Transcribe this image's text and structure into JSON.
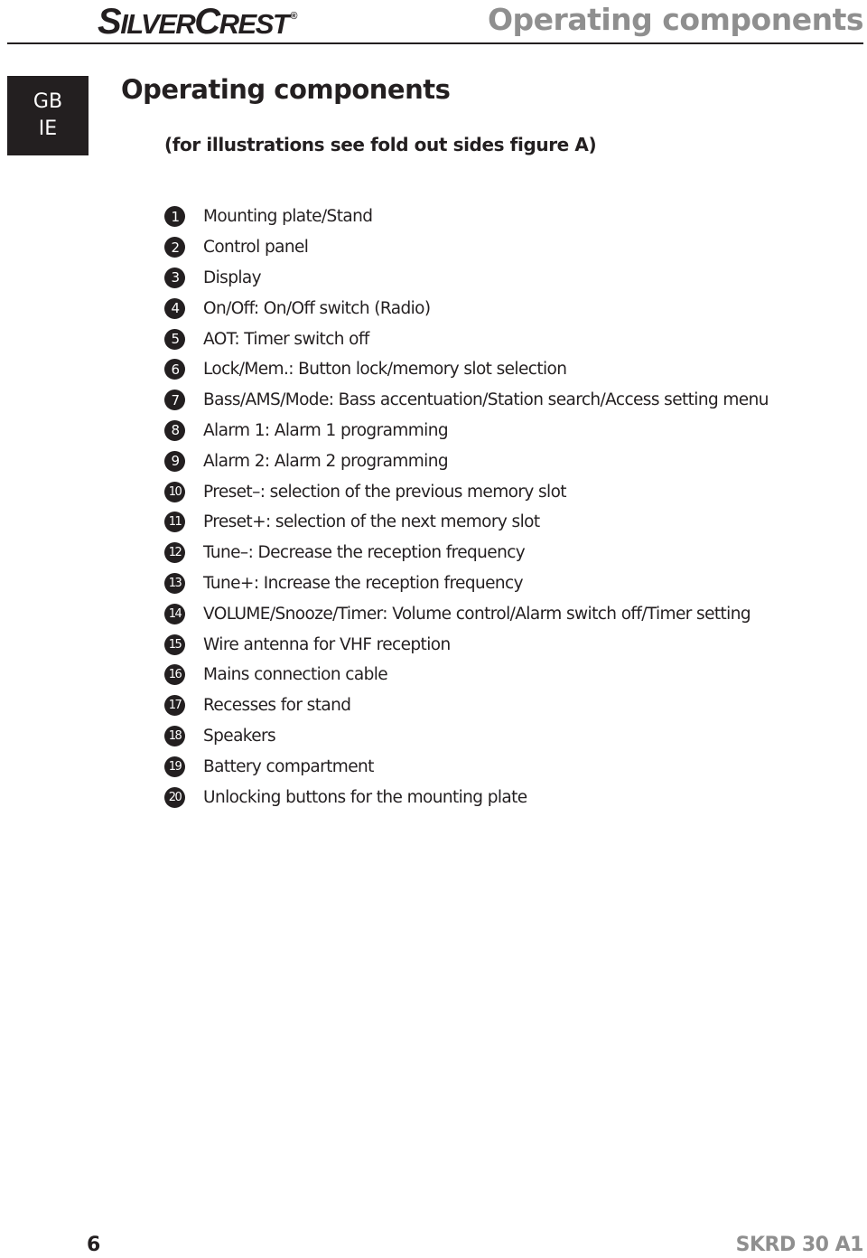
{
  "header": {
    "brand_first": "S",
    "brand_rest1": "ILVER",
    "brand_second": "C",
    "brand_rest2": "REST",
    "brand_mark": "®",
    "title": "Operating components"
  },
  "language_tab": {
    "line1": "GB",
    "line2": "IE"
  },
  "section": {
    "title": "Operating components",
    "subtitle": "(for illustrations see fold out sides figure A)"
  },
  "components": [
    {
      "number": "1",
      "label": "Mounting plate/Stand"
    },
    {
      "number": "2",
      "label": "Control panel"
    },
    {
      "number": "3",
      "label": "Display"
    },
    {
      "number": "4",
      "label": "On/Off: On/Off switch (Radio)"
    },
    {
      "number": "5",
      "label": "AOT: Timer switch off"
    },
    {
      "number": "6",
      "label": "Lock/Mem.: Button lock/memory slot selection"
    },
    {
      "number": "7",
      "label": "Bass/AMS/Mode: Bass accentuation/Station search/Access setting menu"
    },
    {
      "number": "8",
      "label": "Alarm 1: Alarm 1 programming"
    },
    {
      "number": "9",
      "label": "Alarm 2: Alarm 2 programming"
    },
    {
      "number": "10",
      "label": "Preset–: selection of the previous memory slot"
    },
    {
      "number": "11",
      "label": "Preset+: selection of the next memory slot"
    },
    {
      "number": "12",
      "label": "Tune–: Decrease the reception frequency"
    },
    {
      "number": "13",
      "label": "Tune+: Increase the reception frequency"
    },
    {
      "number": "14",
      "label": "VOLUME/Snooze/Timer: Volume control/Alarm switch off/Timer setting"
    },
    {
      "number": "15",
      "label": "Wire antenna for VHF reception"
    },
    {
      "number": "16",
      "label": "Mains connection cable"
    },
    {
      "number": "17",
      "label": "Recesses for stand"
    },
    {
      "number": "18",
      "label": "Speakers"
    },
    {
      "number": "19",
      "label": "Battery compartment"
    },
    {
      "number": "20",
      "label": "Unlocking buttons for the mounting plate"
    }
  ],
  "footer": {
    "page_number": "6",
    "model_code": "SKRD 30 A1"
  }
}
